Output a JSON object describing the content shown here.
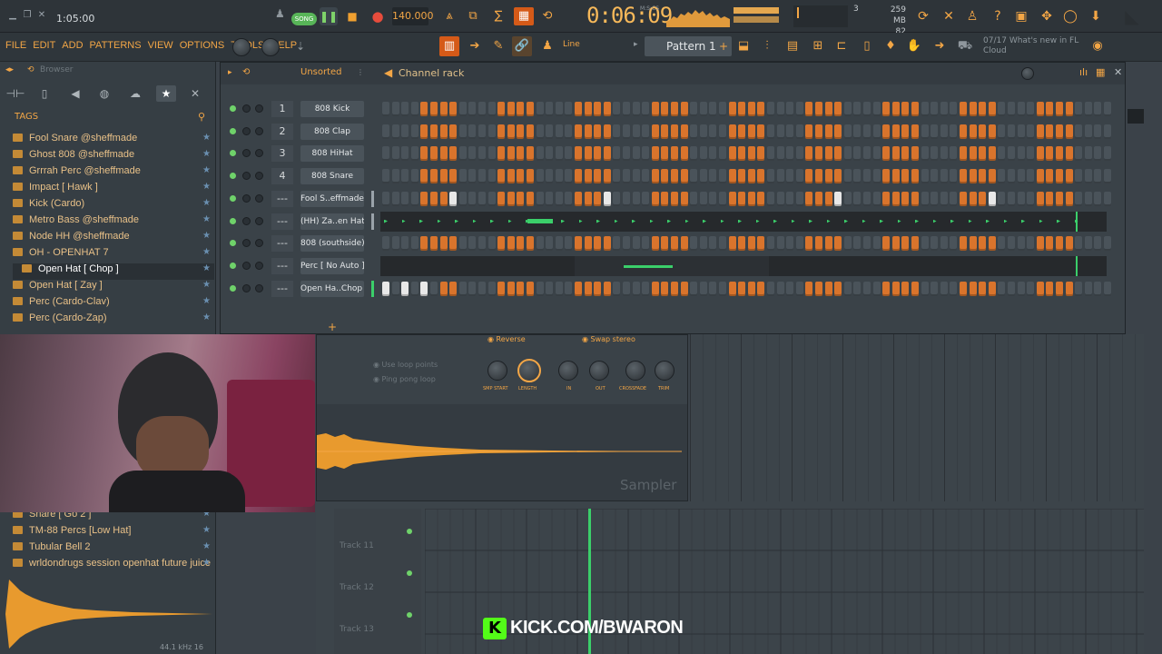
{
  "toolbar": {
    "song_time": "1:05:00",
    "mode_label": "SONG",
    "tempo": "140.000",
    "time_display": "0:06:09",
    "time_label": "M:S:CS",
    "counter": "3",
    "memory_mb": "259 MB",
    "cpu": "82",
    "accent": "#f3a646"
  },
  "menu": {
    "items": [
      "FILE",
      "EDIT",
      "ADD",
      "PATTERNS",
      "VIEW",
      "OPTIONS",
      "TOOLS",
      "HELP"
    ],
    "snap_label": "Line",
    "pattern_label": "Pattern 1",
    "news_date": "07/17",
    "news_text": "What's new in FL",
    "news_text2": "Cloud"
  },
  "browser": {
    "title": "Browser",
    "tags_label": "TAGS",
    "items": [
      {
        "label": "Fool Snare @sheffmade"
      },
      {
        "label": "Ghost 808 @sheffmade"
      },
      {
        "label": "Grrrah Perc @sheffmade"
      },
      {
        "label": "Impact [ Hawk ]"
      },
      {
        "label": "Kick (Cardo)"
      },
      {
        "label": "Metro Bass @sheffmade"
      },
      {
        "label": "Node HH @sheffmade"
      },
      {
        "label": "OH - OPENHAT 7"
      },
      {
        "label": "Open Hat [ Chop ]"
      },
      {
        "label": "Open Hat [ Zay ]"
      },
      {
        "label": "Perc (Cardo-Clav)"
      },
      {
        "label": "Perc (Cardo-Zap)"
      }
    ],
    "items_lower": [
      {
        "label": "Snare [ Go 2 ]"
      },
      {
        "label": "TM-88 Percs [Low Hat]"
      },
      {
        "label": "Tubular Bell 2"
      },
      {
        "label": "wrldondrugs session openhat future juice"
      }
    ],
    "wave_info": "44.1 kHz 16"
  },
  "rack": {
    "filter_label": "Unsorted",
    "title": "Channel rack",
    "channels": [
      {
        "num": "1",
        "name": "808 Kick",
        "pattern": "0000111100001111000011110000111100001111000011110000111100001111000011110000",
        "type": "steps"
      },
      {
        "num": "2",
        "name": "808 Clap",
        "pattern": "0000111100001111000011110000111100001111000011110000111100001111000011110000",
        "type": "steps"
      },
      {
        "num": "3",
        "name": "808 HiHat",
        "pattern": "0000111100001111000011110000111100001111000011110000111100001111000011110000",
        "type": "steps"
      },
      {
        "num": "4",
        "name": "808 Snare",
        "pattern": "0000111100001111000011110000111100001111000011110000111100001111000011110000",
        "type": "steps"
      },
      {
        "num": "---",
        "name": "Fool S..effmade",
        "pattern": "0000111200001111000011120000111100001111000011120000111100001112000011110000",
        "type": "steps"
      },
      {
        "num": "---",
        "name": "(HH) Za..en Hat",
        "type": "notes"
      },
      {
        "num": "---",
        "name": "808 (southside)",
        "pattern": "0000111100001111000011110000111100001111000011110000111100001111000011110000",
        "type": "steps"
      },
      {
        "num": "---",
        "name": "Perc [ No Auto ]",
        "type": "notes2"
      },
      {
        "num": "---",
        "name": "Open Ha..Chop ]",
        "pattern": "2020201100001111000011110000111100001111000011110000111100001111000011110000",
        "type": "steps"
      }
    ]
  },
  "sampler": {
    "reverse_label": "Reverse",
    "swap_label": "Swap stereo",
    "loop_label": "Use loop points",
    "pingpong_label": "Ping pong loop",
    "knob_labels": [
      "SMP START",
      "LENGTH",
      "IN",
      "OUT",
      "CROSSFADE",
      "TRIM"
    ],
    "title": "Sampler",
    "num": "16"
  },
  "playlist": {
    "tracks": [
      "Track 11",
      "Track 12",
      "Track 13"
    ]
  },
  "stream": {
    "banner": "KICK.COM/BWARON"
  }
}
